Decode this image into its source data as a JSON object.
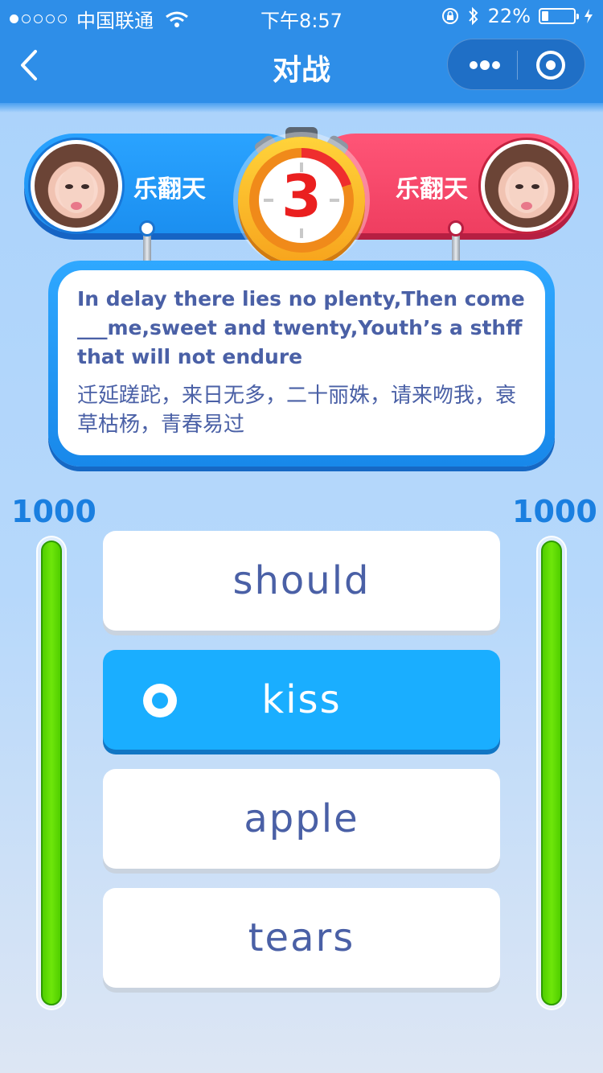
{
  "status_bar": {
    "carrier": "中国联通",
    "time": "下午8:57",
    "battery": "22%",
    "battery_level": 0.22
  },
  "nav": {
    "title": "对战"
  },
  "players": {
    "left": {
      "name": "乐翻天",
      "score": "1000",
      "bar_level": 1.0
    },
    "right": {
      "name": "乐翻天",
      "score": "1000",
      "bar_level": 1.0
    }
  },
  "timer": {
    "value": "3"
  },
  "question": {
    "english": "In delay there lies no plenty,Then come ___me,sweet and twenty,Youth’s a sthff that will not endure",
    "chinese": "迁延蹉跎，来日无多，二十丽姝，请来吻我，衰草枯杨，青春易过"
  },
  "options": [
    {
      "label": "should",
      "selected": false
    },
    {
      "label": "kiss",
      "selected": true
    },
    {
      "label": "apple",
      "selected": false
    },
    {
      "label": "tears",
      "selected": false
    }
  ],
  "colors": {
    "nav_blue": "#2e8ee8",
    "player_left": "#1b8ff0",
    "player_right": "#ef3e60",
    "selected_option": "#1aaeff",
    "text_blue": "#4a60a6",
    "meter_green": "#6ee60a"
  }
}
